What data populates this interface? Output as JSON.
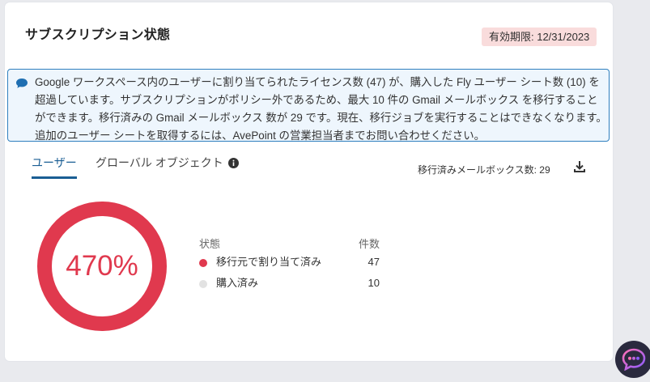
{
  "card": {
    "title": "サブスクリプション状態",
    "expiry_badge": "有効期限: 12/31/2023"
  },
  "info_banner": {
    "icon": "chat-bubble-icon",
    "text": "Google ワークスペース内のユーザーに割り当てられたライセンス数 (47) が、購入した Fly ユーザー シート数 (10) を超過しています。サブスクリプションがポリシー外であるため、最大 10 件の Gmail メールボックス を移行することができます。移行済みの Gmail メールボックス 数が 29 です。現在、移行ジョブを実行することはできなくなります。追加のユーザー シートを取得するには、AvePoint の営業担当者までお問い合わせください。"
  },
  "tabs": [
    {
      "label": "ユーザー",
      "active": true
    },
    {
      "label": "グローバル オブジェクト",
      "active": false
    }
  ],
  "migrated_mailboxes": "移行済みメールボックス数: 29",
  "usage": {
    "percent_label": "470%",
    "legend_header_status": "状態",
    "legend_header_count": "件数",
    "items": [
      {
        "label": "移行元で割り当て済み",
        "count": "47",
        "color": "#e0394e"
      },
      {
        "label": "購入済み",
        "count": "10",
        "color": "#e2e2e2"
      }
    ]
  },
  "colors": {
    "accent": "#1a5e94",
    "danger": "#e0394e",
    "badge_bg": "#f9dcdc",
    "info_border": "#2f7fbe"
  }
}
